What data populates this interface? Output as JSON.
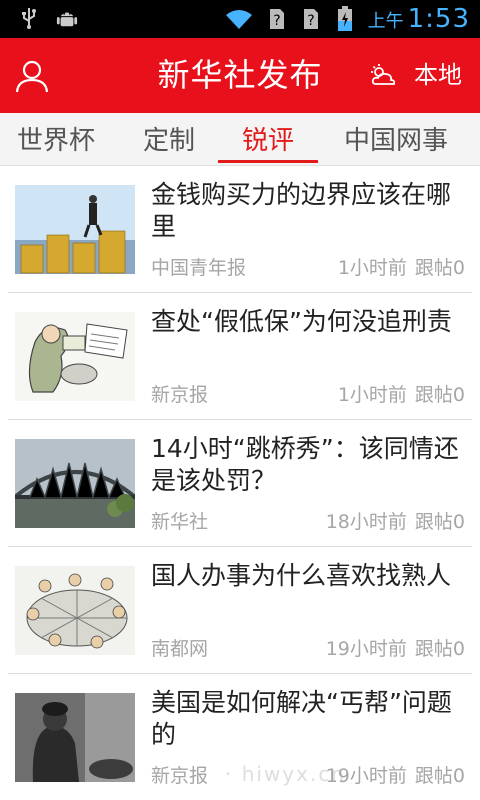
{
  "statusbar": {
    "icons": [
      "usb-icon",
      "android-debug-icon",
      "wifi-icon",
      "no-sim-icon",
      "no-sim-icon",
      "battery-charging-icon"
    ],
    "ampm": "上午",
    "time": "1:53"
  },
  "header": {
    "title": "新华社发布",
    "local_label": "本地",
    "accent": "#e7101b"
  },
  "tabs": [
    {
      "label": "世界杯"
    },
    {
      "label": "定制"
    },
    {
      "label": "锐评"
    },
    {
      "label": "中国网事"
    }
  ],
  "active_tab": "锐评",
  "news": [
    {
      "title": "金钱购买力的边界应该在哪里",
      "source": "中国青年报",
      "time": "1小时前",
      "replies": "跟帖0"
    },
    {
      "title": "查处“假低保”为何没追刑责",
      "source": "新京报",
      "time": "1小时前",
      "replies": "跟帖0"
    },
    {
      "title": "14小时“跳桥秀”：该同情还是该处罚？",
      "source": "新华社",
      "time": "18小时前",
      "replies": "跟帖0"
    },
    {
      "title": "国人办事为什么喜欢找熟人",
      "source": "南都网",
      "time": "19小时前",
      "replies": "跟帖0"
    },
    {
      "title": "美国是如何解决“丐帮”问题的",
      "source": "新京报",
      "time": "19小时前",
      "replies": "跟帖0"
    }
  ],
  "watermark": "· hiwyx.cn"
}
